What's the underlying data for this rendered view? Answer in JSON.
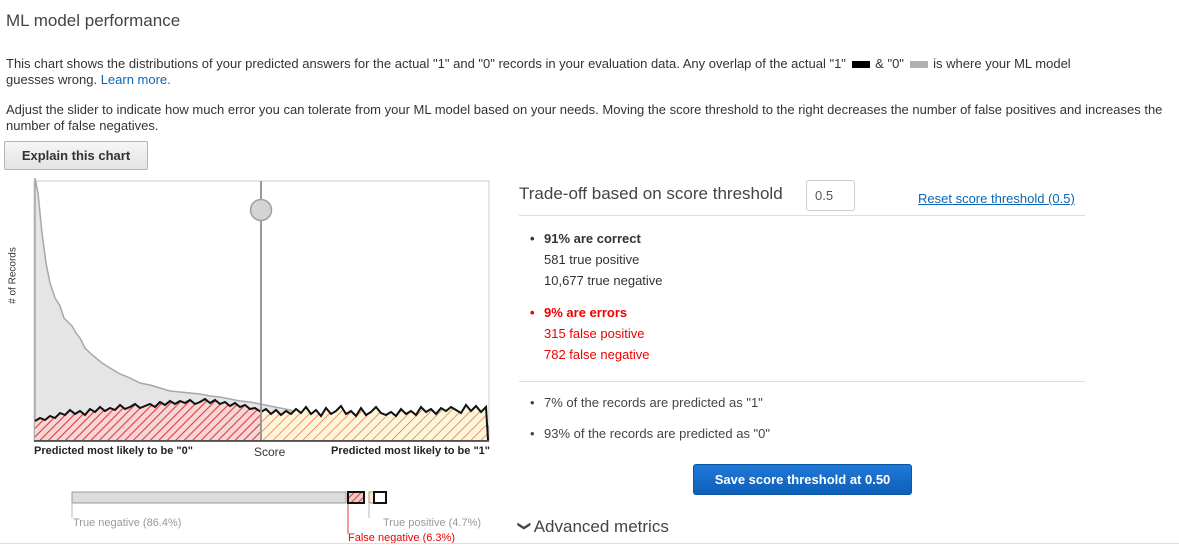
{
  "page": {
    "title": "ML model performance",
    "description_1": "This chart shows the distributions of your predicted answers for the actual \"1\" and \"0\" records in your evaluation data. Any overlap of the actual \"1\"",
    "description_1_mid": "& \"0\"",
    "description_1_end": "is where your ML model",
    "description_1_line2": "guesses wrong.",
    "learn_more": "Learn more.",
    "description_2": "Adjust the slider to indicate how much error you can tolerate from your ML model based on your needs. Moving the score threshold to the right decreases the number of false positives and increases the number of false negatives.",
    "explain_button": "Explain this chart"
  },
  "colors": {
    "actual_1": "#000000",
    "actual_0": "#b0b0b0",
    "false_negative": "#e00000",
    "link": "#0b66b7",
    "true_positive_fill": "#fffbe0",
    "button_primary": "#1a6fd0"
  },
  "chart": {
    "ylabel": "# of Records",
    "x_left_label": "Predicted most likely to be \"0\"",
    "x_mid_label": "Score",
    "x_right_label": "Predicted most likely to be \"1\"",
    "threshold": 0.5
  },
  "distribution_bar": {
    "true_negative": "True negative (86.4%)",
    "true_positive": "True positive (4.7%)",
    "false_negative": "False negative (6.3%)"
  },
  "tradeoff": {
    "title": "Trade-off based on score threshold",
    "threshold_value": "0.5",
    "reset_link": "Reset score threshold (0.5)",
    "correct_heading": "91% are correct",
    "true_positive": "581 true positive",
    "true_negative": "10,677 true negative",
    "errors_heading": "9% are errors",
    "false_positive": "315 false positive",
    "false_negative": "782 false negative",
    "predicted_1": "7% of the records are predicted as \"1\"",
    "predicted_0": "93% of the records are predicted as \"0\"",
    "save_button": "Save score threshold at 0.50",
    "advanced_metrics": "Advanced metrics"
  }
}
